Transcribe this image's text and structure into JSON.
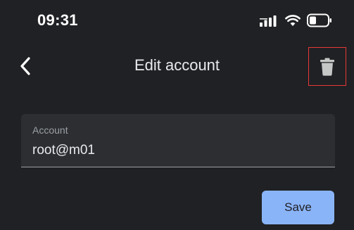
{
  "status_bar": {
    "time": "09:31",
    "icons": [
      "signal-icon",
      "wifi-icon",
      "battery-icon"
    ]
  },
  "app_bar": {
    "title": "Edit account",
    "back_icon": "chevron-left-icon",
    "delete_icon": "trash-icon"
  },
  "form": {
    "account_label": "Account",
    "account_value": "root@m01"
  },
  "actions": {
    "save_label": "Save"
  },
  "colors": {
    "background": "#202124",
    "field_background": "#2d2e31",
    "primary_button": "#8ab4f8",
    "highlight_border": "#e53935"
  }
}
